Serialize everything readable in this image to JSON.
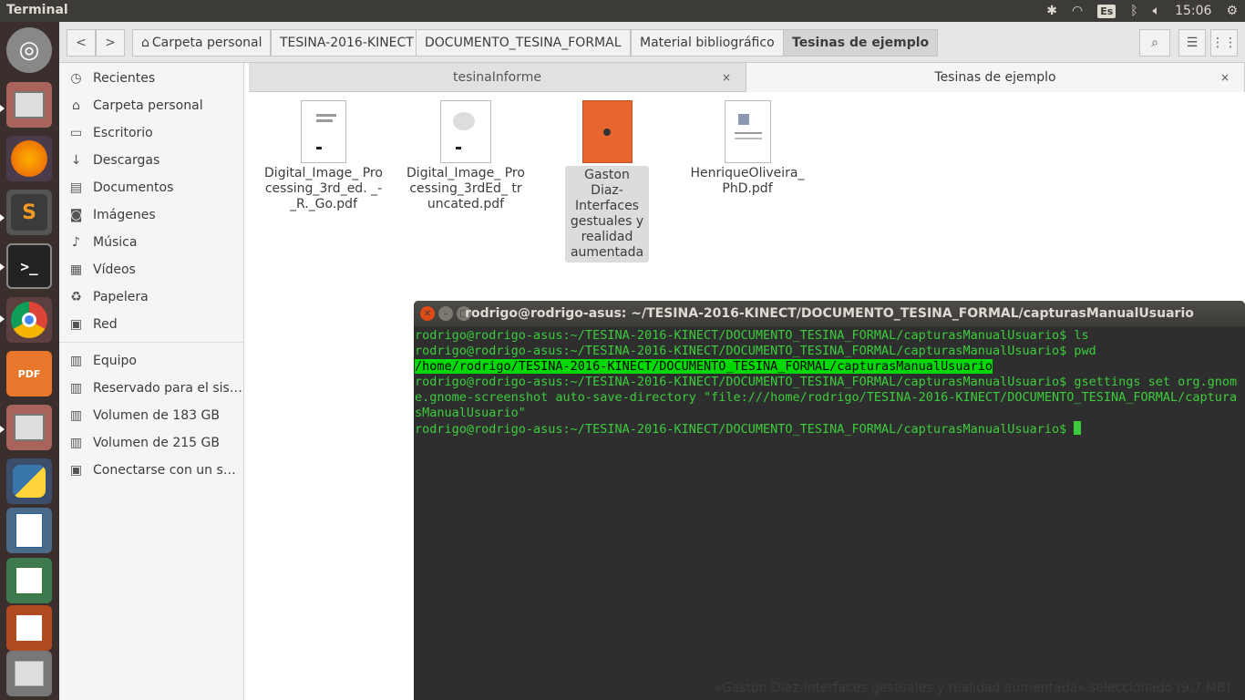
{
  "topbar": {
    "title": "Terminal",
    "keyboard_layout": "Es",
    "clock": "15:06",
    "icons": [
      "bluetooth-icon",
      "wifi-icon",
      "keyboard-icon",
      "bluetooth-icon",
      "volume-icon",
      "gear-icon"
    ]
  },
  "launcher": {
    "apps": [
      "ubuntu-dash",
      "files",
      "firefox",
      "sublime-text",
      "terminal",
      "chrome",
      "pdf-editor",
      "files",
      "python",
      "libreoffice-writer",
      "libreoffice-calc",
      "libreoffice-impress",
      "trash"
    ]
  },
  "nav": {
    "back_label": "<",
    "forward_label": ">",
    "breadcrumbs": [
      "Carpeta personal",
      "TESINA-2016-KINECT",
      "DOCUMENTO_TESINA_FORMAL",
      "Material bibliográfico",
      "Tesinas de ejemplo"
    ]
  },
  "sidebar": {
    "items": [
      {
        "icon": "clock-icon",
        "label": "Recientes"
      },
      {
        "icon": "home-icon",
        "label": "Carpeta personal"
      },
      {
        "icon": "folder-icon",
        "label": "Escritorio"
      },
      {
        "icon": "download-icon",
        "label": "Descargas"
      },
      {
        "icon": "document-icon",
        "label": "Documentos"
      },
      {
        "icon": "camera-icon",
        "label": "Imágenes"
      },
      {
        "icon": "music-icon",
        "label": "Música"
      },
      {
        "icon": "video-icon",
        "label": "Vídeos"
      },
      {
        "icon": "trash-icon",
        "label": "Papelera"
      },
      {
        "icon": "network-icon",
        "label": "Red"
      },
      {
        "icon": "drive-icon",
        "label": "Equipo"
      },
      {
        "icon": "drive-icon",
        "label": "Reservado para el sist…"
      },
      {
        "icon": "drive-icon",
        "label": "Volumen de 183 GB"
      },
      {
        "icon": "drive-icon",
        "label": "Volumen de 215 GB"
      },
      {
        "icon": "network-icon",
        "label": "Conectarse con un ser…"
      }
    ]
  },
  "tabs": [
    {
      "label": "tesinaInforme",
      "close": "×"
    },
    {
      "label": "Tesinas de ejemplo",
      "close": "×"
    }
  ],
  "files": [
    {
      "name": "Digital_Image_ Processing_3rd_ed. _-_R._Go.pdf"
    },
    {
      "name": "Digital_Image_ Processing_3rdEd_ truncated.pdf"
    },
    {
      "name": "Gaston Diaz-Interfaces gestuales y realidad aumentada"
    },
    {
      "name": "HenriqueOliveira_ PhD.pdf"
    }
  ],
  "terminal": {
    "title": "rodrigo@rodrigo-asus: ~/TESINA-2016-KINECT/DOCUMENTO_TESINA_FORMAL/capturasManualUsuario",
    "lines": [
      "rodrigo@rodrigo-asus:~/TESINA-2016-KINECT/DOCUMENTO_TESINA_FORMAL/capturasManualUsuario$ ls",
      "rodrigo@rodrigo-asus:~/TESINA-2016-KINECT/DOCUMENTO_TESINA_FORMAL/capturasManualUsuario$ pwd",
      "/home/rodrigo/TESINA-2016-KINECT/DOCUMENTO_TESINA_FORMAL/capturasManualUsuario",
      "rodrigo@rodrigo-asus:~/TESINA-2016-KINECT/DOCUMENTO_TESINA_FORMAL/capturasManualUsuario$ gsettings set org.gnome.gnome-screenshot auto-save-directory \"file:///home/rodrigo/TESINA-2016-KINECT/DOCUMENTO_TESINA_FORMAL/capturasManualUsuario\"",
      "rodrigo@rodrigo-asus:~/TESINA-2016-KINECT/DOCUMENTO_TESINA_FORMAL/capturasManualUsuario$ "
    ]
  },
  "status": {
    "text": "«Gaston Diaz-Interfaces gestuales y realidad aumentada» seleccionado  (9,7 MB)"
  },
  "colors": {
    "topbar": "#3c3b37",
    "launcher": "#3a2f2c",
    "terminal_text": "#3ed33e",
    "terminal_bg": "#2f2f2f",
    "highlight": "#00e000"
  }
}
